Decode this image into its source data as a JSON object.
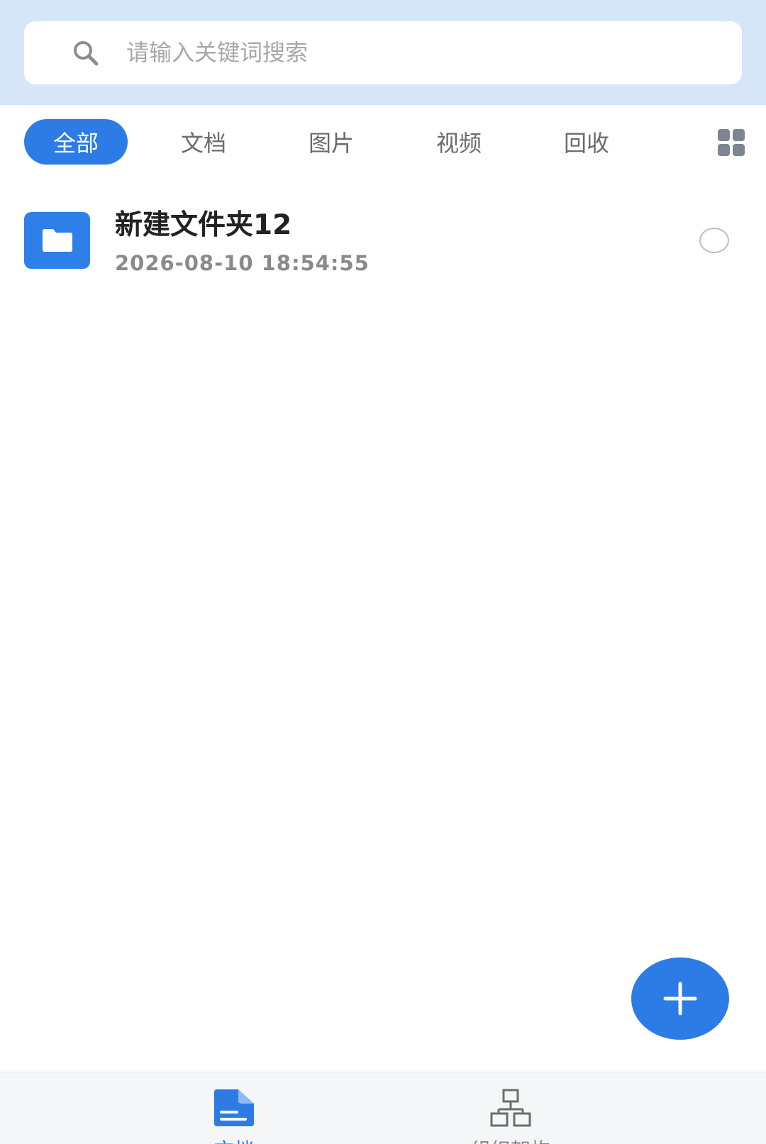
{
  "search": {
    "placeholder": "请输入关键词搜索",
    "value": ""
  },
  "tabs": [
    {
      "label": "全部",
      "active": true
    },
    {
      "label": "文档",
      "active": false
    },
    {
      "label": "图片",
      "active": false
    },
    {
      "label": "视频",
      "active": false
    },
    {
      "label": "回收",
      "active": false
    }
  ],
  "files": [
    {
      "name": "新建文件夹12",
      "date": "2026-08-10 18:54:55",
      "type": "folder"
    }
  ],
  "bottom_nav": {
    "items": [
      {
        "label": "文档",
        "icon": "document-icon",
        "active": true
      },
      {
        "label": "组织架构",
        "icon": "org-chart-icon",
        "active": false
      }
    ]
  },
  "colors": {
    "accent": "#2d7be4",
    "header_bg": "#d6e6f8",
    "text_secondary": "#8a8a8a"
  },
  "icons": {
    "search": "search-icon",
    "view_toggle": "grid-view-icon",
    "folder": "folder-icon",
    "add": "plus-icon"
  }
}
